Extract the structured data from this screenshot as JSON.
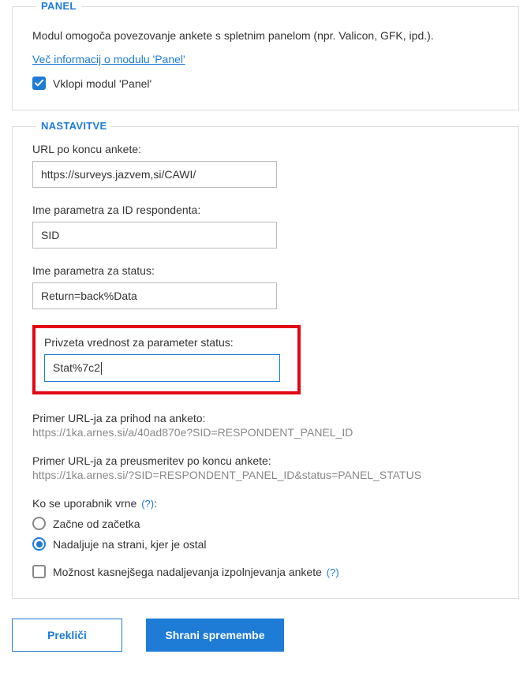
{
  "panel": {
    "legend": "PANEL",
    "description": "Modul omogoča povezovanje ankete s spletnim panelom (npr. Valicon, GFK, ipd.).",
    "more_info_link": "Več informacij o modulu 'Panel'",
    "enable_label": "Vklopi modul 'Panel'"
  },
  "settings": {
    "legend": "NASTAVITVE",
    "url_end": {
      "label": "URL po koncu ankete:",
      "value": "https://surveys.jazvem,si/CAWI/"
    },
    "param_id": {
      "label": "Ime parametra za ID respondenta:",
      "value": "SID"
    },
    "param_status": {
      "label": "Ime parametra za status:",
      "value": "Return=back%Data"
    },
    "default_status": {
      "label": "Privzeta vrednost za parameter status:",
      "value": "Stat%7c2"
    },
    "example_entry": {
      "label": "Primer URL-ja za prihod na anketo:",
      "url": "https://1ka.arnes.si/a/40ad870e?SID=RESPONDENT_PANEL_ID"
    },
    "example_redirect": {
      "label": "Primer URL-ja za preusmeritev po koncu ankete:",
      "url": "https://1ka.arnes.si/?SID=RESPONDENT_PANEL_ID&status=PANEL_STATUS"
    },
    "return_section": {
      "label": "Ko se uporabnik vrne ",
      "help": "(?)",
      "colon": ":",
      "option_restart": "Začne od začetka",
      "option_continue": "Nadaljuje na strani, kjer je ostal"
    },
    "later": {
      "label": "Možnost kasnejšega nadaljevanja izpolnjevanja ankete ",
      "help": "(?)"
    }
  },
  "buttons": {
    "cancel": "Prekliči",
    "save": "Shrani spremembe"
  }
}
